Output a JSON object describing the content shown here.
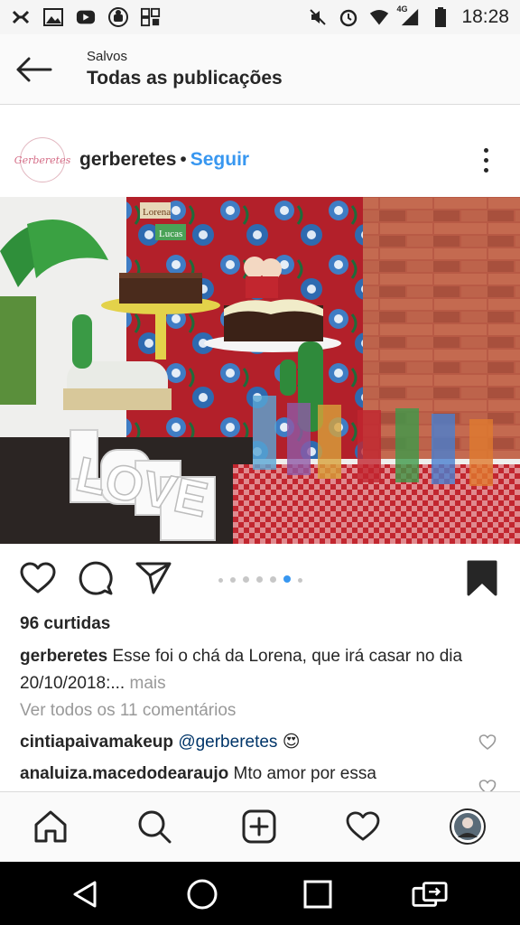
{
  "status_bar": {
    "time": "18:28",
    "network": "4G",
    "left_icons": [
      "close-x-icon",
      "image-icon",
      "youtube-icon",
      "android-icon",
      "qr-icon"
    ],
    "right_icons": [
      "mute-icon",
      "alarm-icon",
      "wifi-icon",
      "signal-icon",
      "battery-icon"
    ]
  },
  "header": {
    "subtitle": "Salvos",
    "title": "Todas as publicações"
  },
  "post": {
    "username": "gerberetes",
    "separator": "•",
    "follow_label": "Seguir",
    "avatar_text": "Gerberetes",
    "photo_label_1": "Lorena",
    "photo_label_2": "Lucas",
    "photo_sign": "LOVE",
    "carousel": {
      "count": 7,
      "active_index": 5
    },
    "likes": "96 curtidas",
    "caption_user": "gerberetes",
    "caption_text": " Esse foi o chá da Lorena, que irá casar no dia 20/10/2018:...",
    "caption_more": " mais",
    "view_all_comments": "Ver todos os 11 comentários",
    "comments": [
      {
        "user": "cintiapaivamakeup",
        "mention": "@gerberetes",
        "text": "",
        "emoji": "😍"
      },
      {
        "user": "analuiza.macedodearaujo",
        "mention": "",
        "text": " Mto amor por essa",
        "emoji": ""
      }
    ]
  },
  "tab_bar": {
    "items": [
      "home-icon",
      "search-icon",
      "add-post-icon",
      "heart-icon",
      "profile-avatar"
    ]
  },
  "nav_bar": {
    "items": [
      "back-triangle-icon",
      "home-circle-icon",
      "recents-square-icon",
      "screen-rotate-icon"
    ]
  },
  "colors": {
    "link_blue": "#3897f0",
    "text_dark": "#262626",
    "text_gray": "#999999"
  }
}
